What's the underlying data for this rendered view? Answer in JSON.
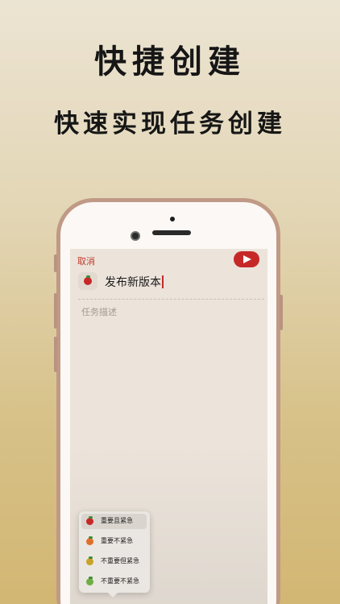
{
  "promo": {
    "title": "快捷创建",
    "subtitle": "快速实现任务创建"
  },
  "app": {
    "cancel_label": "取消",
    "start_button_icon": "play-icon",
    "task_title": "发布新版本",
    "description_placeholder": "任务描述",
    "accent_color": "#c62828",
    "priority_menu": [
      {
        "label": "重要且紧急",
        "color": "#c62828",
        "selected": true
      },
      {
        "label": "重要不紧急",
        "color": "#e06f2a",
        "selected": false
      },
      {
        "label": "不重要但紧急",
        "color": "#c9a227",
        "selected": false
      },
      {
        "label": "不重要不紧急",
        "color": "#6fae43",
        "selected": false
      }
    ]
  }
}
